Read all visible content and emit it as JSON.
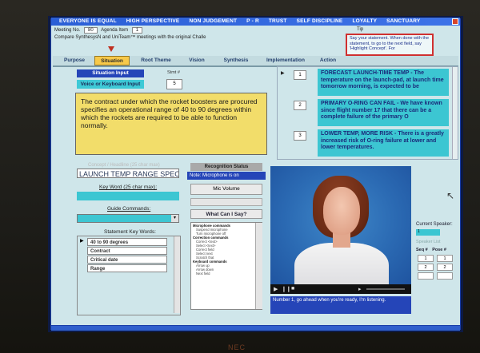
{
  "window": {
    "title_items": [
      "EVERYONE IS EQUAL",
      "HIGH PERSPECTIVE",
      "NON JUDGEMENT",
      "P - R",
      "TRUST",
      "SELF DISCIPLINE",
      "LOYALTY",
      "SANCTUARY"
    ]
  },
  "header": {
    "meeting_label": "Meeting No.",
    "meeting_value": "80",
    "agenda_label": "Agenda Item",
    "agenda_value": "1",
    "compare_text": "Compare SynthesysN and UniTeam™ meetings with the original Challe",
    "tip_label": "Tip",
    "tip_text": "Say your statement.  When done with the statement, to go to the next field, say 'Highlight Concept'.  For"
  },
  "tabs": [
    {
      "label": "Purpose"
    },
    {
      "label": "Situation"
    },
    {
      "label": "Root Theme"
    },
    {
      "label": "Vision"
    },
    {
      "label": "Synthesis"
    },
    {
      "label": "Implementation"
    },
    {
      "label": "Action"
    }
  ],
  "input": {
    "situation_label": "Situation Input",
    "voice_label": "Voice or Keyboard Input",
    "stmt_label": "Stmt #",
    "stmt_value": "5",
    "text": "The contract under which the rocket boosters are procured specifies an operational range of 40 to 90 degrees within which the rockets are required to be able to function normally."
  },
  "statements": [
    {
      "num": "1",
      "text": "FORECAST LAUNCH-TIME TEMP - The temperature on the launch-pad, at launch time tomorrow morning, is expected to be"
    },
    {
      "num": "2",
      "text": "PRIMARY O-RING CAN FAIL - We have known since flight number 17 that there can be a complete failure of the primary O"
    },
    {
      "num": "3",
      "text": "LOWER TEMP, MORE RISK - There is a greatly increased risk of O-ring failure at lower and lower temperatures."
    }
  ],
  "concept": {
    "label": "Concept / Headline (25 char max)",
    "value": "LAUNCH TEMP RANGE SPEC",
    "keyword_label": "Key Word (25 char max):",
    "guide_label": "Guide Commands:",
    "statement_keywords_label": "Statement Key Words:",
    "keywords": [
      "40 to 90 degrees",
      "Contract",
      "Critical date",
      "Range"
    ]
  },
  "recognition": {
    "status_label": "Recognition Status",
    "note": "Note: Microphone is on",
    "mic_volume": "Mic Volume",
    "what_can_i_say": "What Can I Say?",
    "commands": [
      {
        "type": "h",
        "text": "Microphone commands"
      },
      {
        "type": "i",
        "text": "Suspend microphone"
      },
      {
        "type": "i",
        "text": "Turn microphone off"
      },
      {
        "type": "h",
        "text": "Correction commands"
      },
      {
        "type": "i",
        "text": "Correct <text>"
      },
      {
        "type": "i",
        "text": "Select <text>"
      },
      {
        "type": "i",
        "text": "Correct field"
      },
      {
        "type": "i",
        "text": "Select next"
      },
      {
        "type": "i",
        "text": "Scratch that"
      },
      {
        "type": "h",
        "text": "Keyboard commands"
      },
      {
        "type": "i",
        "text": "Arrow up"
      },
      {
        "type": "i",
        "text": "Arrow down"
      },
      {
        "type": "i",
        "text": "Next field"
      }
    ]
  },
  "video": {
    "caption": "Number 1, go ahead when you're ready, I'm listening."
  },
  "speaker": {
    "current_label": "Current Speaker:",
    "current_value": "1",
    "list_label": "Speaker List",
    "seq_label": "Seq #",
    "pose_label": "Pose #",
    "rows": [
      {
        "seq": "1",
        "pose": "1"
      },
      {
        "seq": "2",
        "pose": "2"
      }
    ]
  },
  "footer": {
    "bezel_text": "NEC"
  }
}
